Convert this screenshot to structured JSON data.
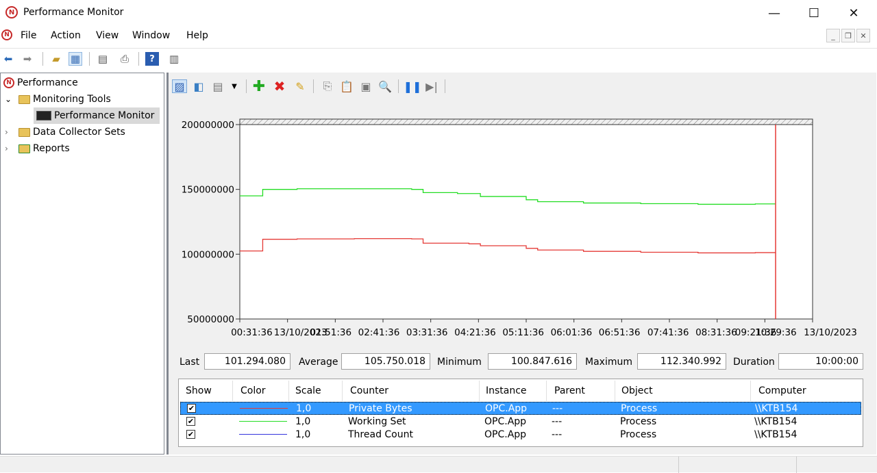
{
  "window": {
    "title": "Performance Monitor",
    "minimize": "—",
    "maximize": "☐",
    "close": "✕"
  },
  "menu": {
    "items": [
      "File",
      "Action",
      "View",
      "Window",
      "Help"
    ]
  },
  "tree": {
    "items": [
      {
        "label": "Performance"
      },
      {
        "label": "Monitoring Tools"
      },
      {
        "label": "Performance Monitor"
      },
      {
        "label": "Data Collector Sets"
      },
      {
        "label": "Reports"
      }
    ]
  },
  "chart_data": {
    "type": "line",
    "ylim": [
      50000000,
      200000000
    ],
    "y_ticks": [
      "200000000",
      "150000000",
      "100000000",
      "50000000"
    ],
    "x_ticks": [
      "00:31:36",
      "13/10/2023",
      "01:51:36",
      "02:41:36",
      "03:31:36",
      "04:21:36",
      "05:11:36",
      "06:01:36",
      "06:51:36",
      "07:41:36",
      "08:31:36",
      "09:21:36",
      "10:29:36",
      "13/10/2023"
    ],
    "series": [
      {
        "name": "Private Bytes",
        "color": "#e53935",
        "x": [
          0,
          0.04,
          0.1,
          0.2,
          0.3,
          0.32,
          0.4,
          0.42,
          0.5,
          0.52,
          0.6,
          0.7,
          0.8,
          0.9,
          0.935
        ],
        "values": [
          102500000,
          111500000,
          111800000,
          112000000,
          111800000,
          108500000,
          108000000,
          106500000,
          104500000,
          103200000,
          102200000,
          101500000,
          101000000,
          101200000,
          101300000
        ]
      },
      {
        "name": "Working Set",
        "color": "#22dd22",
        "x": [
          0,
          0.04,
          0.1,
          0.2,
          0.3,
          0.32,
          0.38,
          0.42,
          0.5,
          0.52,
          0.6,
          0.7,
          0.8,
          0.9,
          0.935
        ],
        "values": [
          145000000,
          150000000,
          150500000,
          150500000,
          150000000,
          147500000,
          146800000,
          144500000,
          142000000,
          140500000,
          139500000,
          139000000,
          138500000,
          138800000,
          138800000
        ]
      }
    ]
  },
  "pm_toolbar": {
    "icons": [
      "chart-view-icon",
      "change-graph-type-icon",
      "dropdown-icon",
      "add-counter-icon",
      "delete-counter-icon",
      "highlight-icon",
      "copy-properties-icon",
      "paste-counter-list-icon",
      "properties-icon",
      "zoom-icon",
      "freeze-display-icon",
      "update-data-icon"
    ]
  },
  "stats": {
    "last_label": "Last",
    "last_value": "101.294.080",
    "average_label": "Average",
    "average_value": "105.750.018",
    "minimum_label": "Minimum",
    "minimum_value": "100.847.616",
    "maximum_label": "Maximum",
    "maximum_value": "112.340.992",
    "duration_label": "Duration",
    "duration_value": "10:00:00"
  },
  "legend": {
    "headers": [
      "Show",
      "Color",
      "Scale",
      "Counter",
      "Instance",
      "Parent",
      "Object",
      "Computer"
    ],
    "rows": [
      {
        "show": "✔",
        "color": "#e53935",
        "scale": "1,0",
        "counter": "Private Bytes",
        "instance": "OPC.App",
        "parent": "---",
        "object": "Process",
        "computer": "\\\\KTB154"
      },
      {
        "show": "✔",
        "color": "#22dd22",
        "scale": "1,0",
        "counter": "Working Set",
        "instance": "OPC.App",
        "parent": "---",
        "object": "Process",
        "computer": "\\\\KTB154"
      },
      {
        "show": "✔",
        "color": "#3333dd",
        "scale": "1,0",
        "counter": "Thread Count",
        "instance": "OPC.App",
        "parent": "---",
        "object": "Process",
        "computer": "\\\\KTB154"
      }
    ]
  }
}
